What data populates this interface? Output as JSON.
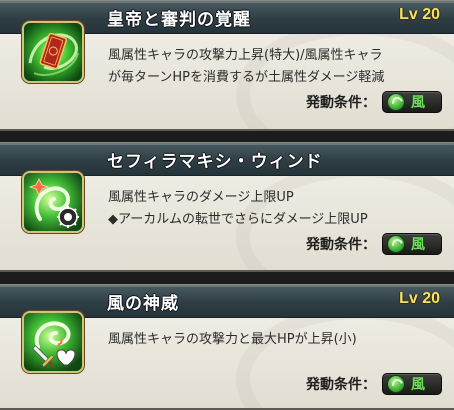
{
  "skills": [
    {
      "title": "皇帝と審判の覚醒",
      "level": "Lv 20",
      "icon": "red-card-wind-swirl-icon",
      "desc_lines": [
        "風属性キャラの攻撃力上昇(特大)/風属性キャラ",
        "が毎ターンHPを消費するが土属性ダメージ軽減"
      ],
      "condition_label": "発動条件：",
      "condition_element": "風"
    },
    {
      "title": "セフィラマキシ・ウィンド",
      "level": "",
      "icon": "wind-swirl-gear-icon",
      "desc_lines": [
        "風属性キャラのダメージ上限UP",
        "◆アーカルムの転世でさらにダメージ上限UP"
      ],
      "condition_label": "発動条件：",
      "condition_element": "風"
    },
    {
      "title": "風の神威",
      "level": "Lv 20",
      "icon": "wind-sword-heart-icon",
      "desc_lines": [
        "風属性キャラの攻撃力と最大HPが上昇(小)"
      ],
      "condition_label": "発動条件：",
      "condition_element": "風"
    }
  ],
  "colors": {
    "header_bg": "#2e3e44",
    "level_text": "#f6e169",
    "wind_element": "#6fe05a",
    "card_bg": "#ece9df"
  }
}
